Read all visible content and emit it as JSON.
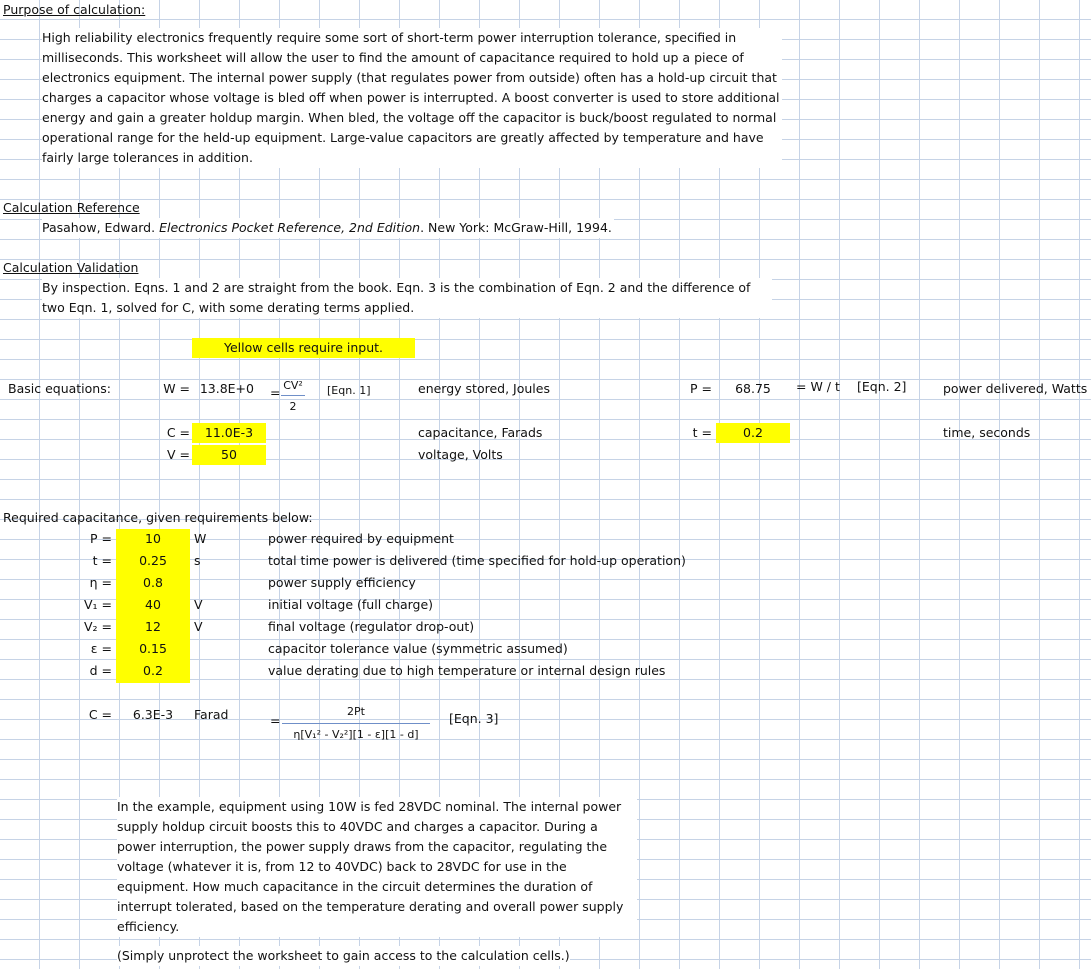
{
  "purpose": {
    "heading": "Purpose of calculation:",
    "text": "High reliability electronics frequently require some sort of short-term power interruption tolerance, specified in milliseconds.  This worksheet will allow the user to find the amount of capacitance required to hold up a piece of electronics equipment.  The internal power supply (that regulates power from outside) often has a hold-up circuit that charges a capacitor whose voltage is bled off when power is interrupted.  A boost converter is used to store additional energy and gain a greater holdup margin.  When bled, the voltage off the capacitor is buck/boost regulated to normal operational range for the held-up equipment.  Large-value capacitors are greatly affected by temperature and have fairly large tolerances in addition."
  },
  "reference": {
    "heading": "Calculation Reference",
    "pre": "Pasahow, Edward.  ",
    "title": "Electronics Pocket Reference, 2nd Edition",
    "post": ".  New York:  McGraw-Hill, 1994."
  },
  "validation": {
    "heading": "Calculation Validation",
    "text": "By inspection.  Eqns. 1 and 2 are straight from the book.  Eqn. 3 is the combination of Eqn. 2 and the difference of two Eqn. 1, solved for C, with some derating terms applied."
  },
  "note_input": "Yellow cells require input.",
  "basic": {
    "label": "Basic equations:",
    "W_label": "W =",
    "W_value": "13.8E+0",
    "eq1_eq": "=",
    "eq1_num": "CV²",
    "eq1_den": "2",
    "eq1_tag": "[Eqn. 1]",
    "eq1_desc": "energy stored, Joules",
    "C_label": "C =",
    "C_value": "11.0E-3",
    "C_desc": "capacitance, Farads",
    "V_label": "V =",
    "V_value": "50",
    "V_desc": "voltage, Volts",
    "P_label": "P =",
    "P_value": "68.75",
    "eq2_expr": "= W / t",
    "eq2_tag": "[Eqn. 2]",
    "P_desc": "power delivered, Watts",
    "t_label": "t =",
    "t_value": "0.2",
    "t_desc": "time, seconds"
  },
  "required": {
    "heading": "Required capacitance, given requirements below:",
    "rows": [
      {
        "label": "P =",
        "value": "10",
        "unit": "W",
        "desc": "power required by equipment"
      },
      {
        "label": "t =",
        "value": "0.25",
        "unit": "s",
        "desc": "total time power is delivered (time specified for hold-up operation)"
      },
      {
        "label": "η =",
        "value": "0.8",
        "unit": "",
        "desc": "power supply efficiency"
      },
      {
        "label": "V₁ =",
        "value": "40",
        "unit": "V",
        "desc": "initial voltage (full charge)"
      },
      {
        "label": "V₂ =",
        "value": "12",
        "unit": "V",
        "desc": "final voltage (regulator drop-out)"
      },
      {
        "label": "ε =",
        "value": "0.15",
        "unit": "",
        "desc": "capacitor tolerance value (symmetric assumed)"
      },
      {
        "label": "d =",
        "value": "0.2",
        "unit": "",
        "desc": "value derating due to high temperature or internal design rules"
      }
    ],
    "result_label": "C =",
    "result_value": "6.3E-3",
    "result_unit": "Farad",
    "eq3_eq": "=",
    "eq3_num": "2Pt",
    "eq3_den": "η[V₁² - V₂²][1 - ε][1 - d]",
    "eq3_tag": "[Eqn. 3]"
  },
  "example": {
    "text": "In the example, equipment using 10W is fed 28VDC nominal.  The internal power supply holdup circuit boosts this to 40VDC and charges a capacitor.  During a power interruption, the power supply draws from the capacitor, regulating the voltage (whatever it is, from 12 to 40VDC) back to 28VDC for use in the equipment.  How much capacitance in the circuit determines the duration of interrupt tolerated, based on the temperature derating and overall power supply efficiency."
  },
  "footer": "(Simply unprotect the worksheet to gain access to the calculation cells.)",
  "colors": {
    "input_fill": "#ffff00",
    "grid": "#c6d3e6"
  }
}
